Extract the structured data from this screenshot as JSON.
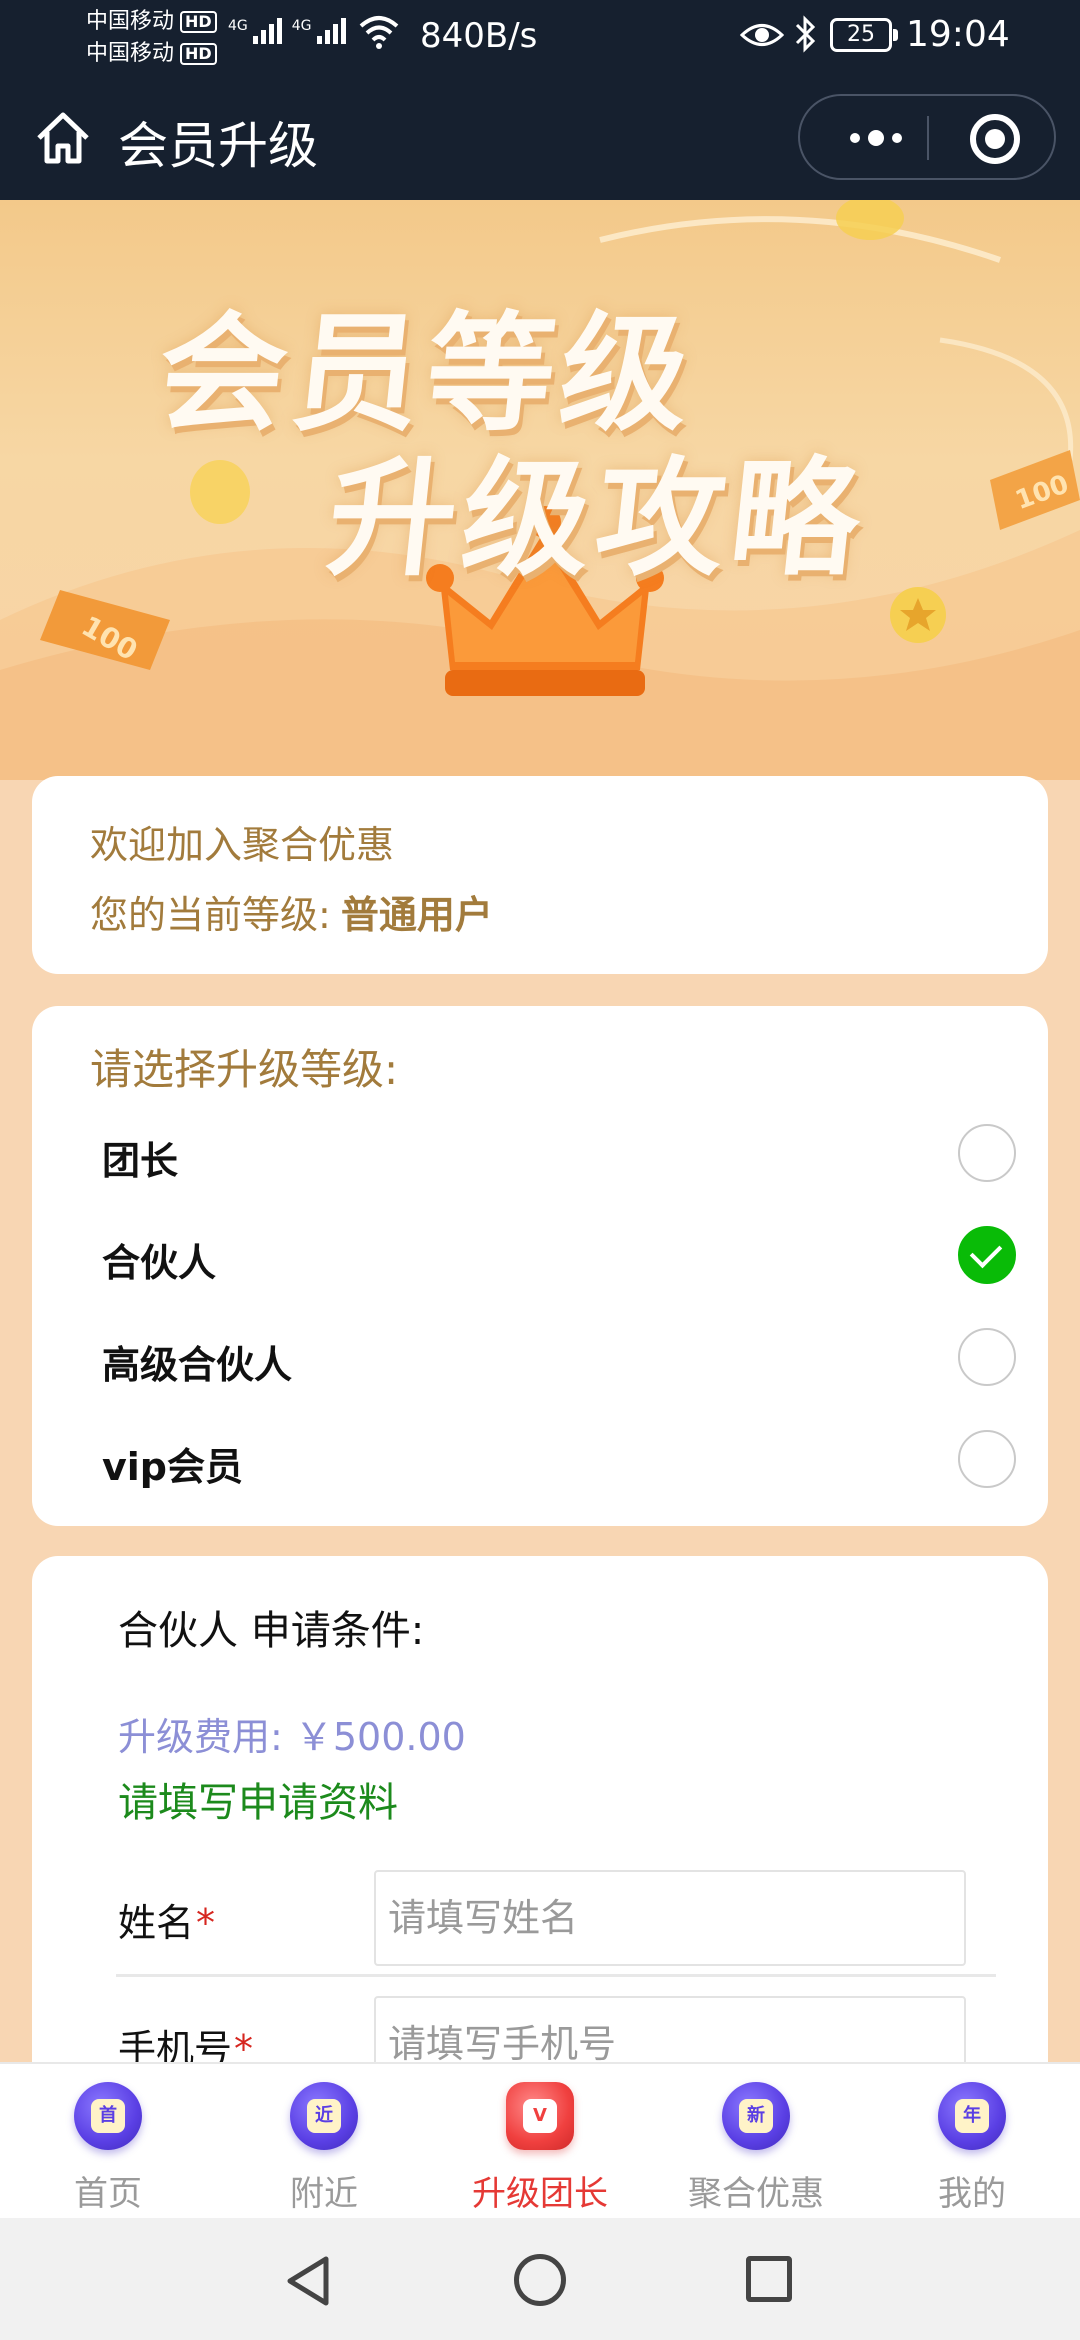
{
  "status_bar": {
    "carrier_1": "中国移动",
    "carrier_2": "中国移动",
    "hd_badge": "HD",
    "network_type": "4G",
    "net_speed": "840B/s",
    "battery": "25",
    "time": "19:04"
  },
  "nav": {
    "title": "会员升级",
    "icons": [
      "home-icon",
      "more-icon",
      "close-icon"
    ]
  },
  "banner": {
    "line1": "会员等级",
    "line2": "升级攻略",
    "coin_label": "100"
  },
  "welcome": {
    "greeting": "欢迎加入聚合优惠",
    "level_label": "您的当前等级:",
    "level_value": "普通用户"
  },
  "select": {
    "title": "请选择升级等级:",
    "options": [
      {
        "label": "团长",
        "checked": false
      },
      {
        "label": "合伙人",
        "checked": true
      },
      {
        "label": "高级合伙人",
        "checked": false
      },
      {
        "label": "vip会员",
        "checked": false
      }
    ]
  },
  "form": {
    "condition_title": "合伙人 申请条件:",
    "fee_line": "升级费用: ￥500.00",
    "fill_prompt": "请填写申请资料",
    "fields": [
      {
        "label": "姓名",
        "required_mark": "*",
        "placeholder": "请填写姓名",
        "value": ""
      },
      {
        "label": "手机号",
        "required_mark": "*",
        "placeholder": "请填写手机号",
        "value": ""
      }
    ]
  },
  "tab_bar": {
    "items": [
      {
        "label": "首页",
        "icon_text": "首",
        "active": false
      },
      {
        "label": "附近",
        "icon_text": "近",
        "active": false
      },
      {
        "label": "升级团长",
        "icon_text": "V",
        "active": true
      },
      {
        "label": "聚合优惠",
        "icon_text": "新",
        "active": false
      },
      {
        "label": "我的",
        "icon_text": "年",
        "active": false
      }
    ],
    "active_color": "#e53935",
    "inactive_color": "#9a9a9a"
  },
  "colors": {
    "header_bg": "#16202f",
    "page_bg": "#f8d6b3",
    "accent_gold": "#a27b3c",
    "check_green": "#09bb07"
  }
}
